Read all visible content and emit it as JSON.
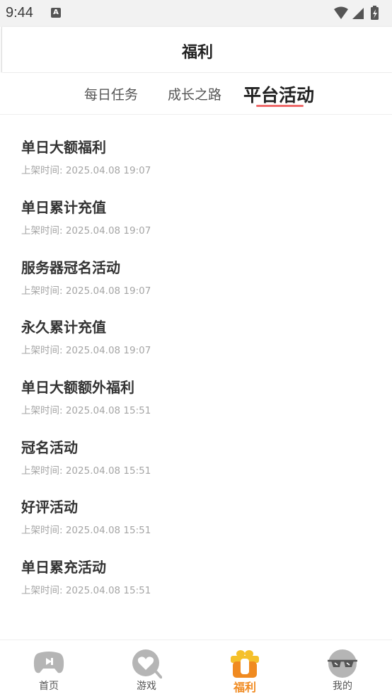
{
  "status_bar": {
    "time": "9:44",
    "notification_glyph": "A"
  },
  "header": {
    "title": "福利"
  },
  "tabs": [
    {
      "label": "每日任务",
      "active": false
    },
    {
      "label": "成长之路",
      "active": false
    },
    {
      "label": "平台活动",
      "active": true
    }
  ],
  "activities": [
    {
      "title": "单日大额福利",
      "time_label": "上架时间: 2025.04.08 19:07"
    },
    {
      "title": "单日累计充值",
      "time_label": "上架时间: 2025.04.08 19:07"
    },
    {
      "title": "服务器冠名活动",
      "time_label": "上架时间: 2025.04.08 19:07"
    },
    {
      "title": "永久累计充值",
      "time_label": "上架时间: 2025.04.08 19:07"
    },
    {
      "title": "单日大额额外福利",
      "time_label": "上架时间: 2025.04.08 15:51"
    },
    {
      "title": "冠名活动",
      "time_label": "上架时间: 2025.04.08 15:51"
    },
    {
      "title": "好评活动",
      "time_label": "上架时间: 2025.04.08 15:51"
    },
    {
      "title": "单日累充活动",
      "time_label": "上架时间: 2025.04.08 15:51"
    }
  ],
  "bottom_nav": [
    {
      "label": "首页",
      "icon": "gamepad-icon",
      "active": false
    },
    {
      "label": "游戏",
      "icon": "heart-search-icon",
      "active": false
    },
    {
      "label": "福利",
      "icon": "gift-icon",
      "active": true
    },
    {
      "label": "我的",
      "icon": "sunglasses-face-icon",
      "active": false
    }
  ],
  "colors": {
    "accent": "#f08a20",
    "tab_underline": "#ef6a6a",
    "muted_text": "#a5a5a5"
  }
}
